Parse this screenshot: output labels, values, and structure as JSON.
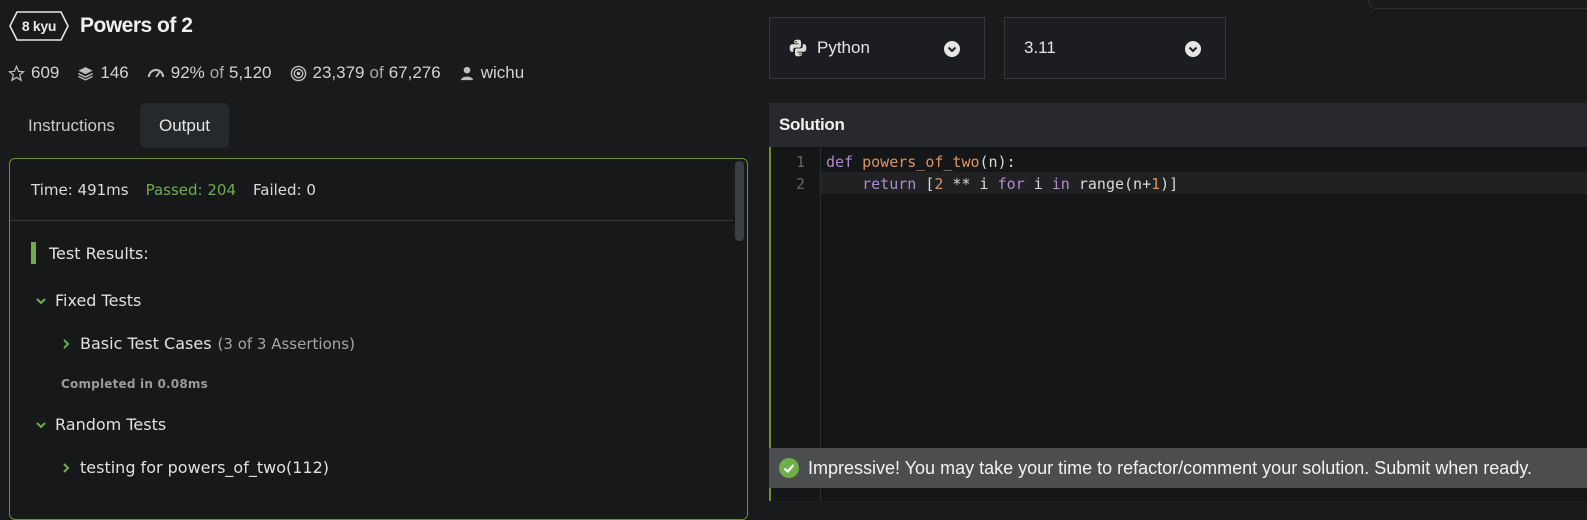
{
  "kata": {
    "rank": "8 kyu",
    "title": "Powers of 2"
  },
  "stats": {
    "stars": "609",
    "collections": "146",
    "satisfaction_pct": "92%",
    "satisfaction_of": "of",
    "satisfaction_votes": "5,120",
    "completed": "23,379",
    "completed_of": "of",
    "attempts": "67,276",
    "author": "wichu"
  },
  "tabs": [
    {
      "label": "Instructions",
      "active": false
    },
    {
      "label": "Output",
      "active": true
    }
  ],
  "output": {
    "time": "Time: 491ms",
    "passed": "Passed: 204",
    "failed": "Failed: 0",
    "results_title": "Test Results:",
    "groups": [
      {
        "label": "Fixed Tests",
        "items": [
          {
            "label": "Basic Test Cases",
            "assertions": "(3 of 3 Assertions)"
          }
        ],
        "completed": "Completed in 0.08ms"
      },
      {
        "label": "Random Tests",
        "items": [
          {
            "label": "testing for powers_of_two(112)"
          }
        ]
      }
    ]
  },
  "language": {
    "selected": "Python",
    "version": "3.11"
  },
  "solution": {
    "header": "Solution",
    "line_numbers": [
      "1",
      "2"
    ],
    "code_lines": [
      "def powers_of_two(n):",
      "    return [2 ** i for i in range(n+1)]"
    ]
  },
  "toast": {
    "message": "Impressive! You may take your time to refactor/comment your solution. Submit when ready."
  },
  "colors": {
    "accent_green": "#6fae48",
    "panel_border": "#6b8f2c",
    "background": "#181a1c"
  },
  "icons": [
    "star-icon",
    "layers-icon",
    "gauge-icon",
    "target-icon",
    "user-icon",
    "python-icon",
    "chevron-down-circle-icon",
    "chevron-right-icon",
    "chevron-down-icon",
    "check-circle-icon"
  ]
}
